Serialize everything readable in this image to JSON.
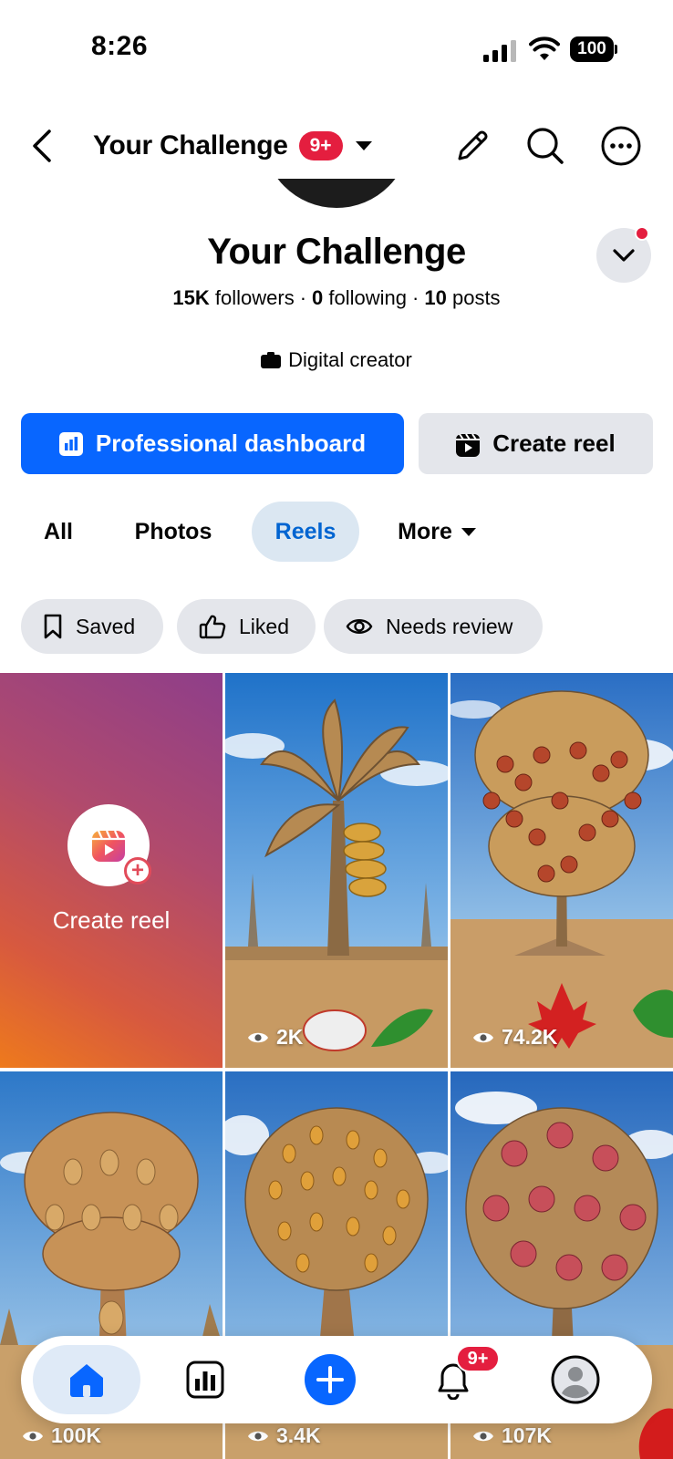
{
  "status_bar": {
    "time": "8:26",
    "battery": "100"
  },
  "header": {
    "title": "Your Challenge",
    "badge": "9+"
  },
  "profile": {
    "name": "Your Challenge",
    "followers_count": "15K",
    "followers_label": "followers",
    "following_count": "0",
    "following_label": "following",
    "posts_count": "10",
    "posts_label": "posts",
    "category": "Digital creator"
  },
  "actions": {
    "dashboard_label": "Professional dashboard",
    "create_reel_label": "Create reel"
  },
  "tabs": [
    {
      "label": "All"
    },
    {
      "label": "Photos"
    },
    {
      "label": "Reels"
    },
    {
      "label": "More"
    }
  ],
  "filters": [
    {
      "label": "Saved",
      "icon": "bookmark-icon"
    },
    {
      "label": "Liked",
      "icon": "thumbs-up-icon"
    },
    {
      "label": "Needs review",
      "icon": "eye-icon"
    }
  ],
  "grid": {
    "create_label": "Create reel",
    "reels": [
      {
        "views": "2K",
        "subject": "banana-tree"
      },
      {
        "views": "74.2K",
        "subject": "tomato-plant"
      },
      {
        "views": "100K",
        "subject": "jackfruit-tree"
      },
      {
        "views": "3.4K",
        "subject": "mango-tree"
      },
      {
        "views": "107K",
        "subject": "hibiscus-bush"
      }
    ]
  },
  "bottom_nav": {
    "notifications_badge": "9+"
  },
  "colors": {
    "primary": "#0866ff",
    "badge": "#e41e3f",
    "active_tab_bg": "#dbe7f2",
    "active_tab_text": "#0064d1"
  }
}
